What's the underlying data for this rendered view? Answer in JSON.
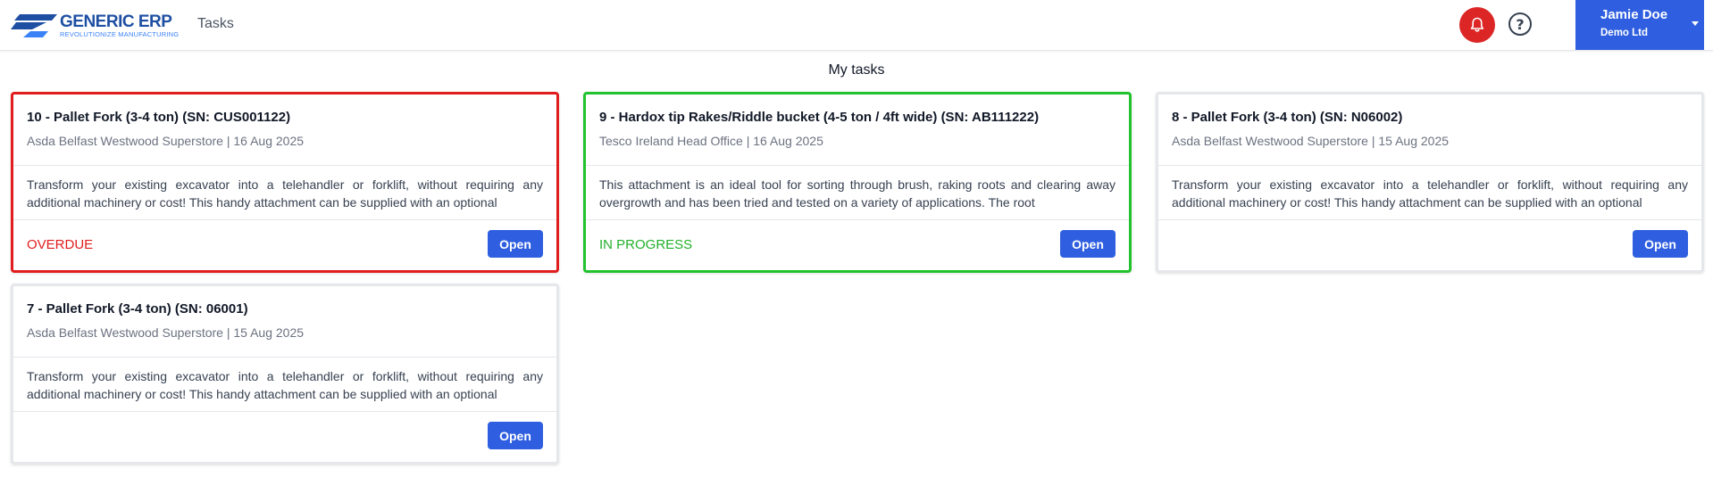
{
  "header": {
    "logo_text": "GENERIC ERP",
    "logo_tagline": "REVOLUTIONIZE MANUFACTURING",
    "nav_label": "Tasks",
    "user": {
      "name": "Jamie Doe",
      "company": "Demo Ltd"
    },
    "icons": {
      "notifications": "bell-icon",
      "help": "question-icon",
      "menu": "caret-down-icon"
    },
    "help_glyph": "?"
  },
  "page_title": "My tasks",
  "colors": {
    "accent": "#2f5fe0",
    "overdue": "#e11d1d",
    "in_progress": "#22c22e",
    "bell": "#dc2626"
  },
  "tasks": [
    {
      "title": "10 - Pallet Fork (3-4 ton) (SN: CUS001122)",
      "location": "Asda Belfast Westwood Superstore",
      "date": "16 Aug 2025",
      "subtitle": "Asda Belfast Westwood Superstore | 16 Aug 2025",
      "description": "Transform your existing excavator into a telehandler or forklift, without requiring any additional machinery or cost! This handy attachment can be supplied with an optional",
      "status": "OVERDUE",
      "button": "Open"
    },
    {
      "title": "9 - Hardox tip Rakes/Riddle bucket (4-5 ton / 4ft wide) (SN: AB111222)",
      "location": "Tesco Ireland Head Office",
      "date": "16 Aug 2025",
      "subtitle": "Tesco Ireland Head Office | 16 Aug 2025",
      "description": "This attachment is an ideal tool for sorting through brush, raking roots and clearing away overgrowth and has been tried and tested on a variety of applications. The root",
      "status": "IN PROGRESS",
      "button": "Open"
    },
    {
      "title": "8 - Pallet Fork (3-4 ton) (SN: N06002)",
      "location": "Asda Belfast Westwood Superstore",
      "date": "15 Aug 2025",
      "subtitle": "Asda Belfast Westwood Superstore | 15 Aug 2025",
      "description": "Transform your existing excavator into a telehandler or forklift, without requiring any additional machinery or cost! This handy attachment can be supplied with an optional",
      "status": "",
      "button": "Open"
    },
    {
      "title": "7 - Pallet Fork (3-4 ton) (SN: 06001)",
      "location": "Asda Belfast Westwood Superstore",
      "date": "15 Aug 2025",
      "subtitle": "Asda Belfast Westwood Superstore | 15 Aug 2025",
      "description": "Transform your existing excavator into a telehandler or forklift, without requiring any additional machinery or cost! This handy attachment can be supplied with an optional",
      "status": "",
      "button": "Open"
    }
  ]
}
